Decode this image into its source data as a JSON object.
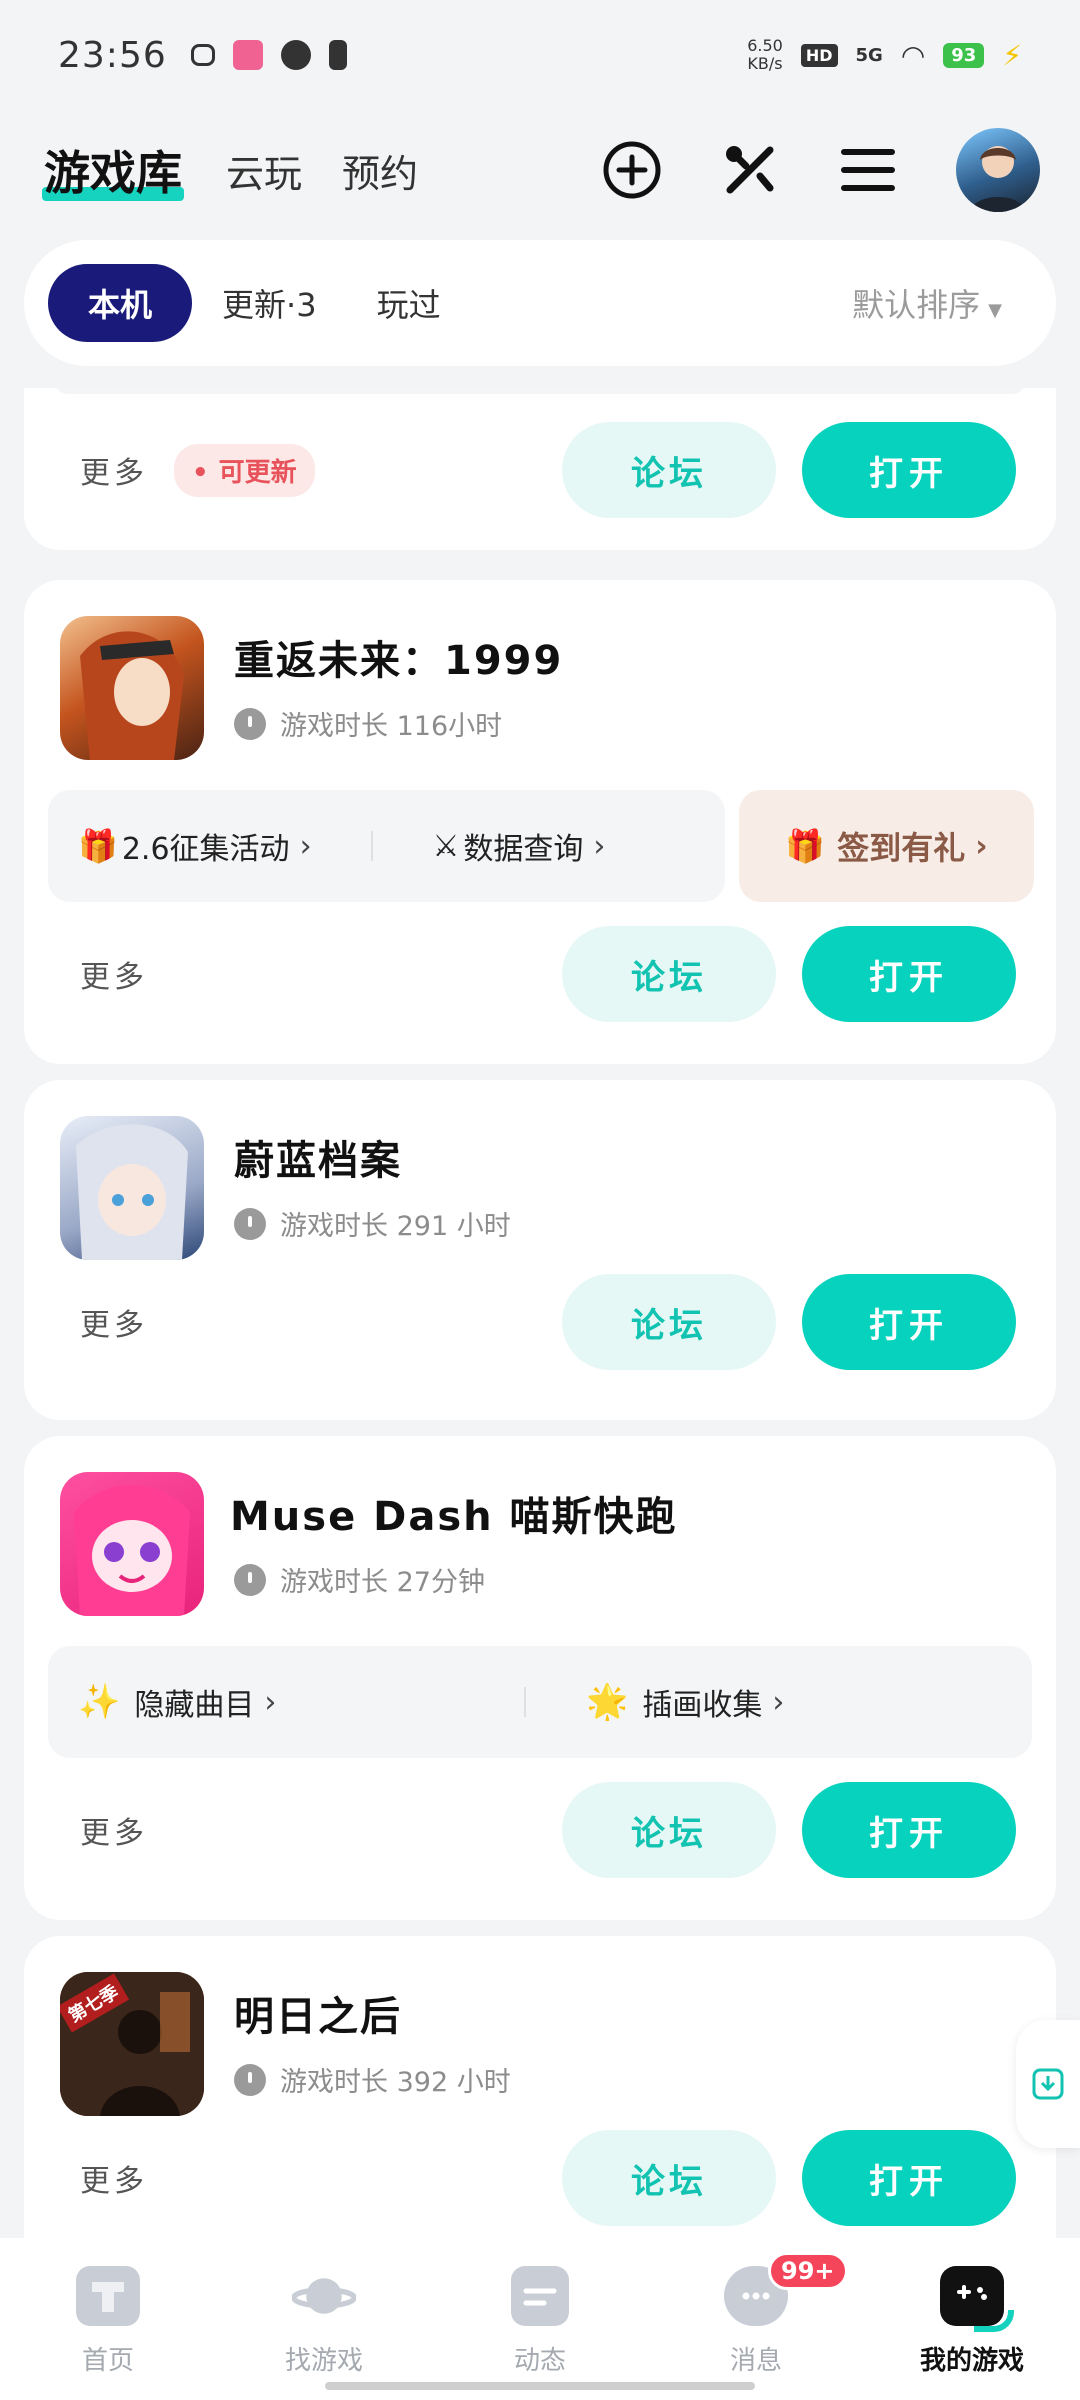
{
  "status_bar": {
    "time": "23:56",
    "speed_value": "6.50",
    "speed_unit": "KB/s",
    "hd": "HD",
    "network": "5G",
    "battery": "93"
  },
  "top_nav": {
    "tabs": [
      "游戏库",
      "云玩",
      "预约"
    ]
  },
  "filter": {
    "chips": [
      "本机",
      "更新·3",
      "玩过"
    ],
    "sort_label": "默认排序"
  },
  "common": {
    "more": "更多",
    "forum": "论坛",
    "open": "打开",
    "update_badge": "可更新"
  },
  "games": [
    {
      "title": "重返未来：1999",
      "playtime": "游戏时长 116小时",
      "links": [
        "2.6征集活动",
        "数据查询"
      ],
      "checkin": "签到有礼"
    },
    {
      "title": "蔚蓝档案",
      "playtime": "游戏时长 291 小时"
    },
    {
      "title": "Muse Dash 喵斯快跑",
      "playtime": "游戏时长 27分钟",
      "links": [
        "隐藏曲目",
        "插画收集"
      ]
    },
    {
      "title": "明日之后",
      "playtime": "游戏时长 392 小时",
      "icon_text": "第七季"
    }
  ],
  "bottom_nav": {
    "items": [
      "首页",
      "找游戏",
      "动态",
      "消息",
      "我的游戏"
    ],
    "message_badge": "99+"
  }
}
